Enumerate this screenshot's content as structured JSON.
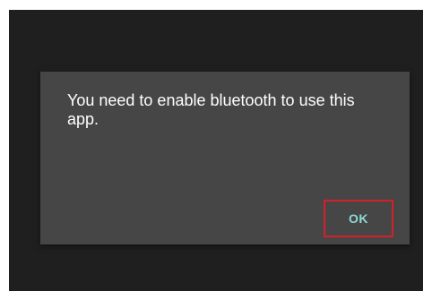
{
  "dialog": {
    "message": "You need to enable bluetooth to use this app.",
    "ok_label": "OK"
  },
  "colors": {
    "screen_background": "#1f1f1f",
    "dialog_background": "#464646",
    "message_text": "#ffffff",
    "button_text": "#8fd8d4",
    "highlight_border": "#d3202a"
  }
}
